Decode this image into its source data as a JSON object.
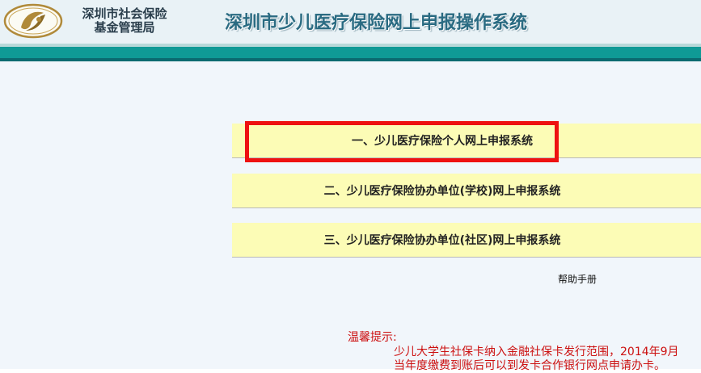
{
  "header": {
    "agency_line1": "深圳市社会保险",
    "agency_line2": "基金管理局",
    "system_title": "深圳市少儿医疗保险网上申报操作系统"
  },
  "menu": {
    "items": [
      {
        "label": "一、少儿医疗保险个人网上申报系统",
        "highlighted": true
      },
      {
        "label": "二、少儿医疗保险协办单位(学校)网上申报系统",
        "highlighted": false
      },
      {
        "label": "三、少儿医疗保险协办单位(社区)网上申报系统",
        "highlighted": false
      }
    ],
    "help_link": "帮助手册"
  },
  "notice": {
    "title": "温馨提示:",
    "lines": [
      "少儿大学生社保卡纳入金融社保卡发行范围，2014年9月",
      "当年度缴费到账后可以到发卡合作银行网点申请办卡。"
    ]
  },
  "colors": {
    "header_bg": "#e9f2f6",
    "teal_band": "#0f9a96",
    "menu_bg": "#fcfcb6",
    "highlight_border": "#ee1111",
    "notice_text": "#cc1010"
  }
}
